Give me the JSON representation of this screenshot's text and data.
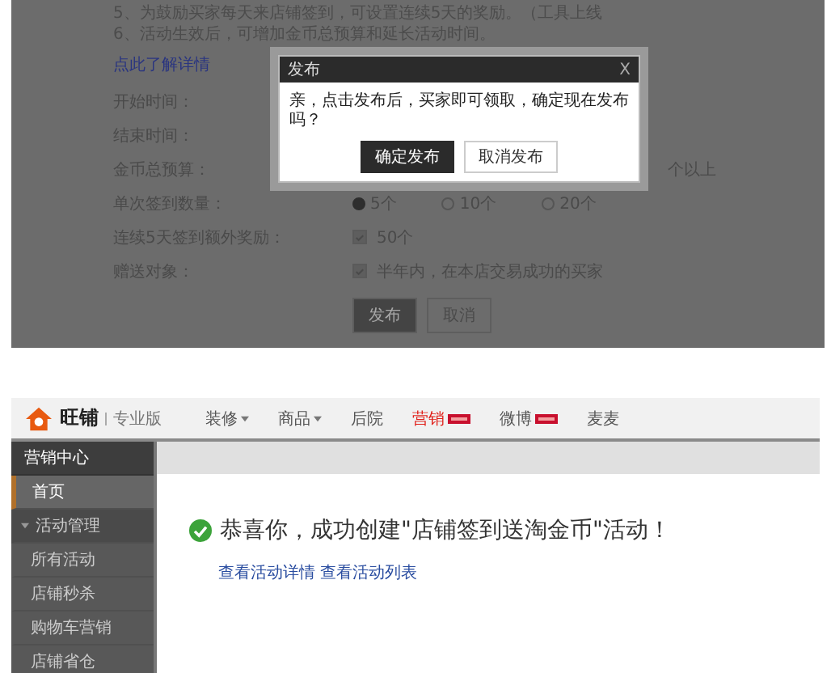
{
  "top_screenshot": {
    "notes": [
      "5、为鼓励买家每天来店铺签到，可设置连续5天的奖励。（工具上线",
      "6、活动生效后，可增加金币总预算和延长活动时间。"
    ],
    "details_link": "点此了解详情",
    "form": [
      {
        "label": "开始时间：",
        "kind": "blank"
      },
      {
        "label": "结束时间：",
        "kind": "blank"
      },
      {
        "label": "金币总预算：",
        "kind": "suffix",
        "text": "个以上"
      },
      {
        "label": "单次签到数量：",
        "kind": "radio",
        "options": [
          {
            "label": "5个",
            "selected": true
          },
          {
            "label": "10个",
            "selected": false
          },
          {
            "label": "20个",
            "selected": false
          }
        ]
      },
      {
        "label": "连续5天签到额外奖励：",
        "kind": "checkbox",
        "checked": true,
        "text": "50个"
      },
      {
        "label": "赠送对象：",
        "kind": "checkbox",
        "checked": true,
        "text": "半年内，在本店交易成功的买家"
      }
    ],
    "buttons": [
      {
        "label": "发布",
        "primary": true
      },
      {
        "label": "取消",
        "primary": false
      }
    ],
    "dialog": {
      "title": "发布",
      "close": "X",
      "message": "亲，点击发布后，买家即可领取，确定现在发布吗？",
      "buttons": [
        {
          "label": "确定发布",
          "primary": true
        },
        {
          "label": "取消发布",
          "primary": false
        }
      ]
    }
  },
  "bottom_screenshot": {
    "logo": {
      "brand": "旺铺",
      "edition": "专业版"
    },
    "nav": [
      {
        "label": "装修",
        "dropdown": true,
        "selected": false,
        "badge": false
      },
      {
        "label": "商品",
        "dropdown": true,
        "selected": false,
        "badge": false
      },
      {
        "label": "后院",
        "dropdown": false,
        "selected": false,
        "badge": false
      },
      {
        "label": "营销",
        "dropdown": false,
        "selected": true,
        "badge": true
      },
      {
        "label": "微博",
        "dropdown": false,
        "selected": false,
        "badge": true
      },
      {
        "label": "麦麦",
        "dropdown": false,
        "selected": false,
        "badge": false
      }
    ],
    "sidebar": {
      "title": "营销中心",
      "items": [
        {
          "label": "首页",
          "kind": "link",
          "selected": true
        },
        {
          "label": "活动管理",
          "kind": "section",
          "expanded": true
        },
        {
          "label": "所有活动",
          "kind": "link",
          "selected": false
        },
        {
          "label": "店铺秒杀",
          "kind": "link",
          "selected": false
        },
        {
          "label": "购物车营销",
          "kind": "link",
          "selected": false
        },
        {
          "label": "店铺省仓",
          "kind": "link",
          "selected": false
        }
      ]
    },
    "success": {
      "message": "恭喜你，成功创建\"店铺签到送淘金币\"活动！",
      "links": [
        "查看活动详情",
        "查看活动列表"
      ]
    }
  }
}
